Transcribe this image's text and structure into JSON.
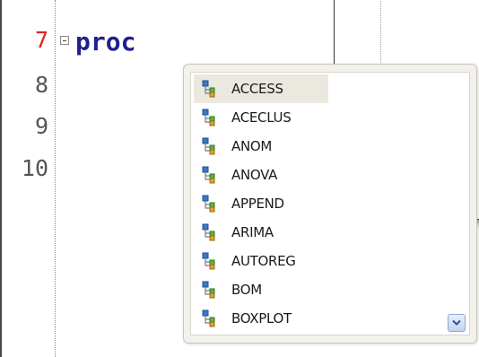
{
  "editor": {
    "lines": [
      {
        "number": "7",
        "current": true
      },
      {
        "number": "8",
        "current": false
      },
      {
        "number": "9",
        "current": false
      },
      {
        "number": "10",
        "current": false
      }
    ],
    "code": "proc",
    "accent_color": "#1f1f8f",
    "current_line_color": "#e02020"
  },
  "autocomplete": {
    "items": [
      {
        "label": "ACCESS",
        "icon": "procedure-icon",
        "selected": true
      },
      {
        "label": "ACECLUS",
        "icon": "procedure-icon",
        "selected": false
      },
      {
        "label": "ANOM",
        "icon": "procedure-icon",
        "selected": false
      },
      {
        "label": "ANOVA",
        "icon": "procedure-icon",
        "selected": false
      },
      {
        "label": "APPEND",
        "icon": "procedure-icon",
        "selected": false
      },
      {
        "label": "ARIMA",
        "icon": "procedure-icon",
        "selected": false
      },
      {
        "label": "AUTOREG",
        "icon": "procedure-icon",
        "selected": false
      },
      {
        "label": "BOM",
        "icon": "procedure-icon",
        "selected": false
      },
      {
        "label": "BOXPLOT",
        "icon": "procedure-icon",
        "selected": false
      }
    ],
    "scroll_icon": "chevron-down-icon"
  }
}
